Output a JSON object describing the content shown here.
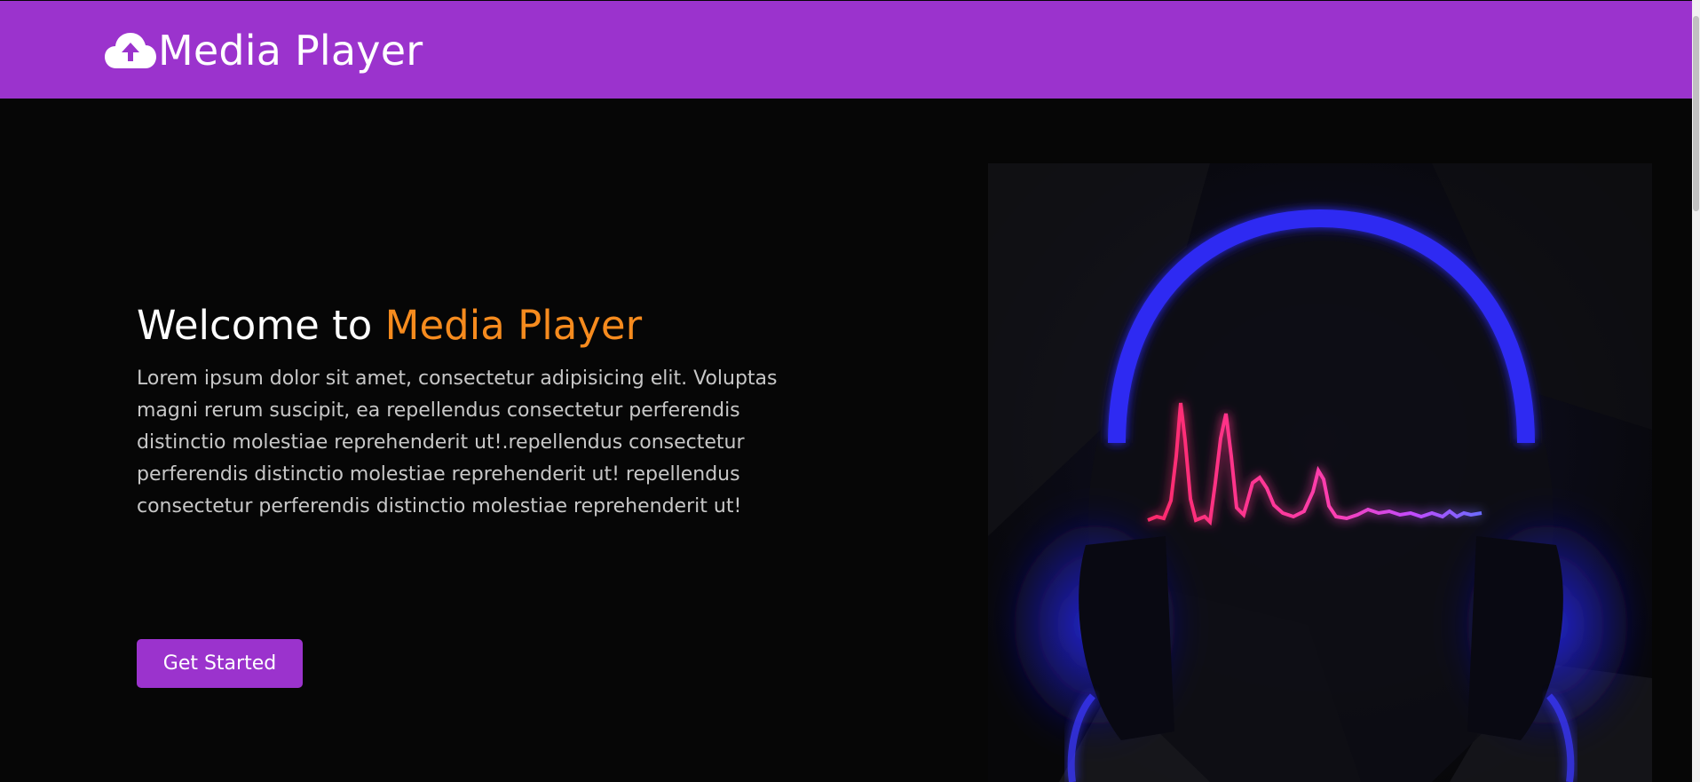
{
  "navbar": {
    "brand_icon": "cloud-upload-icon",
    "brand_title": "Media Player"
  },
  "hero": {
    "heading_prefix": "Welcome to ",
    "heading_accent": "Media Player",
    "description": "Lorem ipsum dolor sit amet, consectetur adipisicing elit. Voluptas magni rerum suscipit, ea repellendus consectetur perferendis distinctio molestiae reprehenderit ut!.repellendus consectetur perferendis distinctio molestiae reprehenderit ut! repellendus consectetur perferendis distinctio molestiae reprehenderit ut!",
    "cta_label": "Get Started",
    "image": "neon-headphones-heartbeat-illustration"
  },
  "colors": {
    "brand_purple": "#9b33cd",
    "accent_orange": "#f68b1e",
    "background": "#060606",
    "text_muted": "#c7c7c7"
  }
}
